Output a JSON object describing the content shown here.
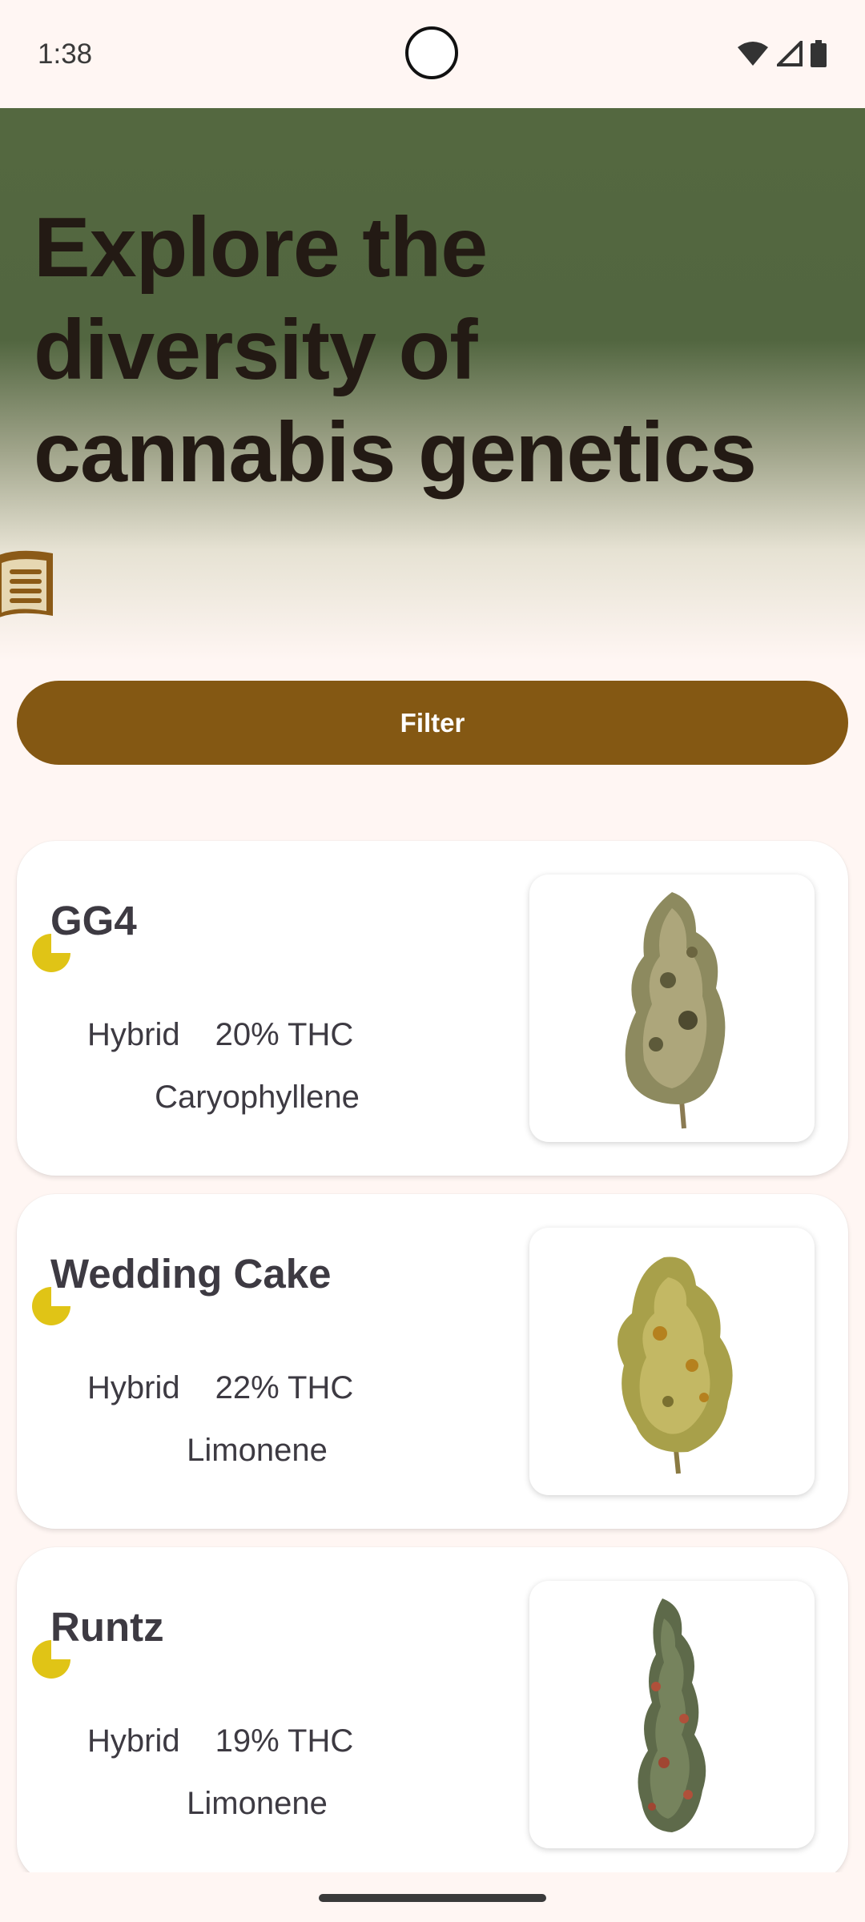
{
  "status": {
    "time": "1:38"
  },
  "hero": {
    "title": "Explore the diversity of cannabis genetics"
  },
  "filter": {
    "label": "Filter"
  },
  "strains": [
    {
      "name": "GG4",
      "type": "Hybrid",
      "thc": "20% THC",
      "terpene": "Caryophyllene",
      "image": "bud-photo-gg4"
    },
    {
      "name": "Wedding Cake",
      "type": "Hybrid",
      "thc": "22% THC",
      "terpene": "Limonene",
      "image": "bud-photo-wedding-cake"
    },
    {
      "name": "Runtz",
      "type": "Hybrid",
      "thc": "19% THC",
      "terpene": "Limonene",
      "image": "bud-photo-runtz"
    }
  ],
  "colors": {
    "accent": "#845813",
    "hero": "#546840",
    "marker": "#e0c416",
    "background": "#fff6f3"
  },
  "icons": [
    "book-icon",
    "wifi-icon",
    "signal-icon",
    "battery-icon"
  ]
}
